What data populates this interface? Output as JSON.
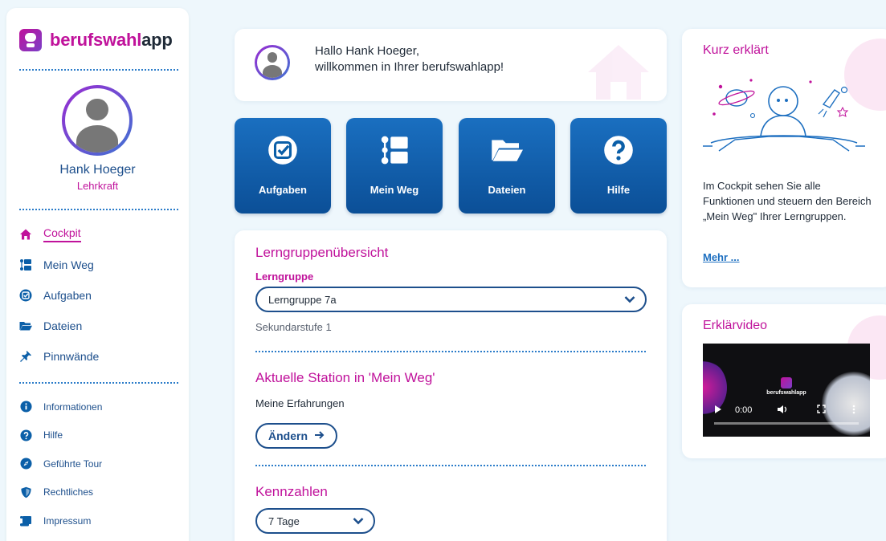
{
  "brand": {
    "part1": "berufswahl",
    "part2": "app"
  },
  "user": {
    "name": "Hank Hoeger",
    "role": "Lehrkraft"
  },
  "nav_main": [
    {
      "label": "Cockpit",
      "icon": "home-icon",
      "active": true
    },
    {
      "label": "Mein Weg",
      "icon": "path-icon",
      "active": false
    },
    {
      "label": "Aufgaben",
      "icon": "task-check-icon",
      "active": false
    },
    {
      "label": "Dateien",
      "icon": "folder-icon",
      "active": false
    },
    {
      "label": "Pinnwände",
      "icon": "pin-icon",
      "active": false
    }
  ],
  "nav_secondary": [
    {
      "label": "Informationen",
      "icon": "info-icon"
    },
    {
      "label": "Hilfe",
      "icon": "help-icon"
    },
    {
      "label": "Geführte Tour",
      "icon": "compass-icon"
    },
    {
      "label": "Rechtliches",
      "icon": "shield-icon"
    },
    {
      "label": "Impressum",
      "icon": "scroll-icon"
    }
  ],
  "welcome": {
    "line1": "Hallo Hank Hoeger,",
    "line2": "willkommen in Ihrer berufswahlapp!"
  },
  "tiles": [
    {
      "label": "Aufgaben",
      "icon": "task-check-icon"
    },
    {
      "label": "Mein Weg",
      "icon": "path-icon"
    },
    {
      "label": "Dateien",
      "icon": "folder-icon"
    },
    {
      "label": "Hilfe",
      "icon": "help-icon"
    }
  ],
  "overview": {
    "title": "Lerngruppenübersicht",
    "group_label": "Lerngruppe",
    "group_value": "Lerngruppe 7a",
    "group_level": "Sekundarstufe 1",
    "station_title": "Aktuelle Station in 'Mein Weg'",
    "station_value": "Meine Erfahrungen",
    "change_button": "Ändern",
    "stats_title": "Kennzahlen",
    "period_value": "7 Tage"
  },
  "explained": {
    "title": "Kurz erklärt",
    "text": "Im Cockpit sehen Sie alle Funktionen und steuern den Bereich „Mein Weg\" Ihrer Lerngruppen.",
    "link": "Mehr ..."
  },
  "video": {
    "title": "Erklärvideo",
    "time": "0:00",
    "logo_text": "berufswahlapp"
  },
  "colors": {
    "accent": "#c0129b",
    "primary": "#1d4f8c",
    "tile": "#0b5fa8",
    "background": "#eef7fc"
  }
}
